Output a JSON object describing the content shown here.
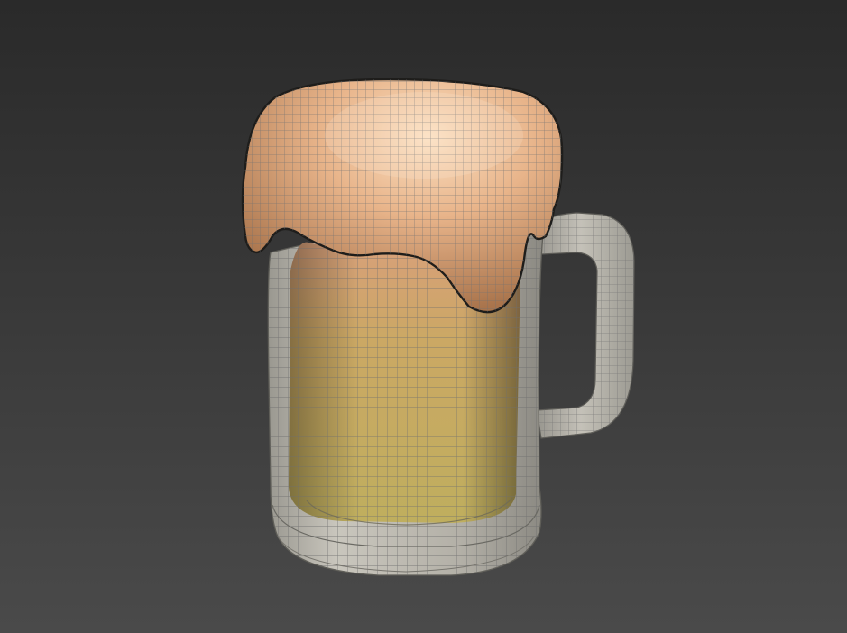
{
  "viewport": {
    "background_top": "#2a2a2a",
    "background_bottom": "#4a4a4a"
  },
  "model": {
    "object": "beer-mug",
    "display_mode": "shaded-wireframe",
    "foam_color": "#e9b88e",
    "beer_color": "#cdb25c",
    "glass_color": "#b9b7ae",
    "wire_color": "#7c7c7c"
  }
}
